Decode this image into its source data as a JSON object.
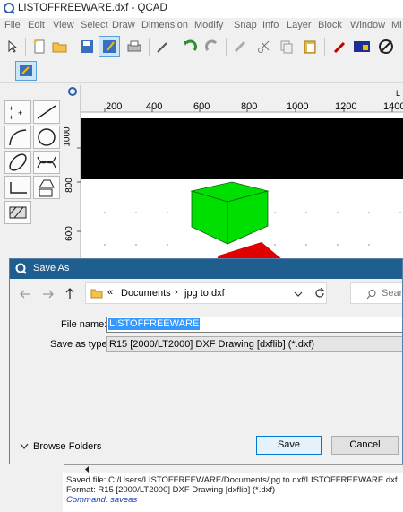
{
  "window": {
    "title": "LISTOFFREEWARE.dxf - QCAD"
  },
  "menu": [
    "File",
    "Edit",
    "View",
    "Select",
    "Draw",
    "Dimension",
    "Modify",
    "Snap",
    "Info",
    "Layer",
    "Block",
    "Window",
    "Mi"
  ],
  "ruler": {
    "x_ticks": [
      "200",
      "400",
      "600",
      "800",
      "1000",
      "1200",
      "1400"
    ],
    "y_ticks": [
      "1000",
      "800",
      "600"
    ],
    "corner_label": "L"
  },
  "dialog": {
    "title": "Save As",
    "breadcrumb": {
      "prefix": "«",
      "folder1": "Documents",
      "sep": "›",
      "folder2": "jpg to dxf"
    },
    "search_placeholder": "Sear",
    "file_name_label": "File name:",
    "file_name_value": "LISTOFFREEWARE",
    "save_type_label": "Save as type:",
    "save_type_value": "R15 [2000/LT2000] DXF Drawing [dxflib] (*.dxf)",
    "browse_folders": "Browse Folders",
    "save_button": "Save",
    "cancel_button": "Cancel"
  },
  "command_history": {
    "line1": "Saved file: C:/Users/LISTOFFREEWARE/Documents/jpg to dxf/LISTOFFREEWARE.dxf",
    "line2": "Format: R15 [2000/LT2000] DXF Drawing [dxflib] (*.dxf)",
    "line3": "Command: saveas"
  },
  "colors": {
    "dialog_title_bg": "#1f5f90",
    "cube_green": "#00e000",
    "cone_red": "#e00000",
    "selection": "#3399ff"
  }
}
